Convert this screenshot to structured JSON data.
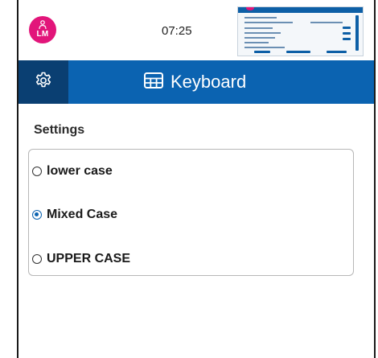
{
  "status_bar": {
    "avatar_initials": "LM",
    "time": "07:25",
    "preview_icon": "screen-preview-thumbnail"
  },
  "header": {
    "settings_icon": "gear-icon",
    "title_icon": "keyboard-icon",
    "title": "Keyboard"
  },
  "settings": {
    "label": "Settings",
    "options": [
      {
        "label": "lower case",
        "selected": false
      },
      {
        "label": "Mixed Case",
        "selected": true
      },
      {
        "label": "UPPER CASE",
        "selected": false
      }
    ]
  },
  "colors": {
    "header_blue": "#0b63b1",
    "header_dark": "#0a3f72",
    "avatar_pink": "#e2157a"
  }
}
